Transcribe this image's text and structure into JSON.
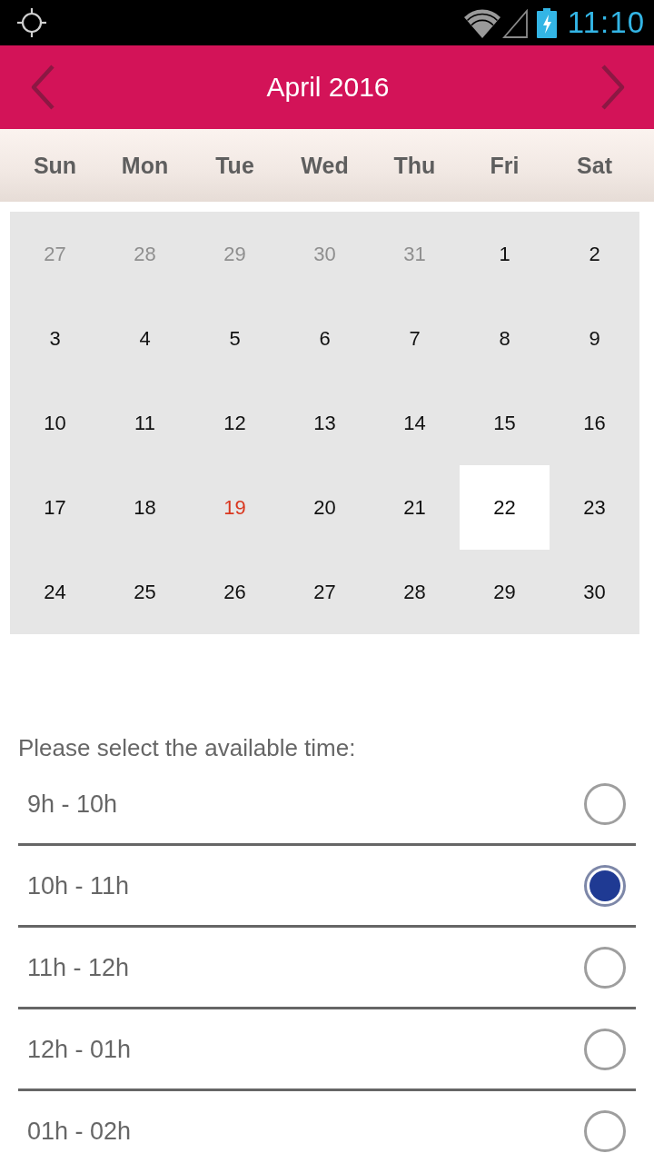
{
  "status_bar": {
    "time": "11:10"
  },
  "header": {
    "title": "April 2016"
  },
  "weekdays": [
    "Sun",
    "Mon",
    "Tue",
    "Wed",
    "Thu",
    "Fri",
    "Sat"
  ],
  "calendar": {
    "weeks": [
      {
        "days": [
          {
            "label": "27",
            "in_month": false,
            "today": false,
            "selected": false
          },
          {
            "label": "28",
            "in_month": false,
            "today": false,
            "selected": false
          },
          {
            "label": "29",
            "in_month": false,
            "today": false,
            "selected": false
          },
          {
            "label": "30",
            "in_month": false,
            "today": false,
            "selected": false
          },
          {
            "label": "31",
            "in_month": false,
            "today": false,
            "selected": false
          },
          {
            "label": "1",
            "in_month": true,
            "today": false,
            "selected": false
          },
          {
            "label": "2",
            "in_month": true,
            "today": false,
            "selected": false
          }
        ]
      },
      {
        "days": [
          {
            "label": "3",
            "in_month": true,
            "today": false,
            "selected": false
          },
          {
            "label": "4",
            "in_month": true,
            "today": false,
            "selected": false
          },
          {
            "label": "5",
            "in_month": true,
            "today": false,
            "selected": false
          },
          {
            "label": "6",
            "in_month": true,
            "today": false,
            "selected": false
          },
          {
            "label": "7",
            "in_month": true,
            "today": false,
            "selected": false
          },
          {
            "label": "8",
            "in_month": true,
            "today": false,
            "selected": false
          },
          {
            "label": "9",
            "in_month": true,
            "today": false,
            "selected": false
          }
        ]
      },
      {
        "days": [
          {
            "label": "10",
            "in_month": true,
            "today": false,
            "selected": false
          },
          {
            "label": "11",
            "in_month": true,
            "today": false,
            "selected": false
          },
          {
            "label": "12",
            "in_month": true,
            "today": false,
            "selected": false
          },
          {
            "label": "13",
            "in_month": true,
            "today": false,
            "selected": false
          },
          {
            "label": "14",
            "in_month": true,
            "today": false,
            "selected": false
          },
          {
            "label": "15",
            "in_month": true,
            "today": false,
            "selected": false
          },
          {
            "label": "16",
            "in_month": true,
            "today": false,
            "selected": false
          }
        ]
      },
      {
        "days": [
          {
            "label": "17",
            "in_month": true,
            "today": false,
            "selected": false
          },
          {
            "label": "18",
            "in_month": true,
            "today": false,
            "selected": false
          },
          {
            "label": "19",
            "in_month": true,
            "today": true,
            "selected": false
          },
          {
            "label": "20",
            "in_month": true,
            "today": false,
            "selected": false
          },
          {
            "label": "21",
            "in_month": true,
            "today": false,
            "selected": false
          },
          {
            "label": "22",
            "in_month": true,
            "today": false,
            "selected": true
          },
          {
            "label": "23",
            "in_month": true,
            "today": false,
            "selected": false
          }
        ]
      },
      {
        "days": [
          {
            "label": "24",
            "in_month": true,
            "today": false,
            "selected": false
          },
          {
            "label": "25",
            "in_month": true,
            "today": false,
            "selected": false
          },
          {
            "label": "26",
            "in_month": true,
            "today": false,
            "selected": false
          },
          {
            "label": "27",
            "in_month": true,
            "today": false,
            "selected": false
          },
          {
            "label": "28",
            "in_month": true,
            "today": false,
            "selected": false
          },
          {
            "label": "29",
            "in_month": true,
            "today": false,
            "selected": false
          },
          {
            "label": "30",
            "in_month": true,
            "today": false,
            "selected": false
          }
        ]
      }
    ]
  },
  "time_picker": {
    "prompt": "Please select the available time:",
    "slots": [
      {
        "label": "9h - 10h",
        "selected": false
      },
      {
        "label": "10h - 11h",
        "selected": true
      },
      {
        "label": "11h - 12h",
        "selected": false
      },
      {
        "label": "12h - 01h",
        "selected": false
      },
      {
        "label": "01h - 02h",
        "selected": false
      }
    ]
  }
}
